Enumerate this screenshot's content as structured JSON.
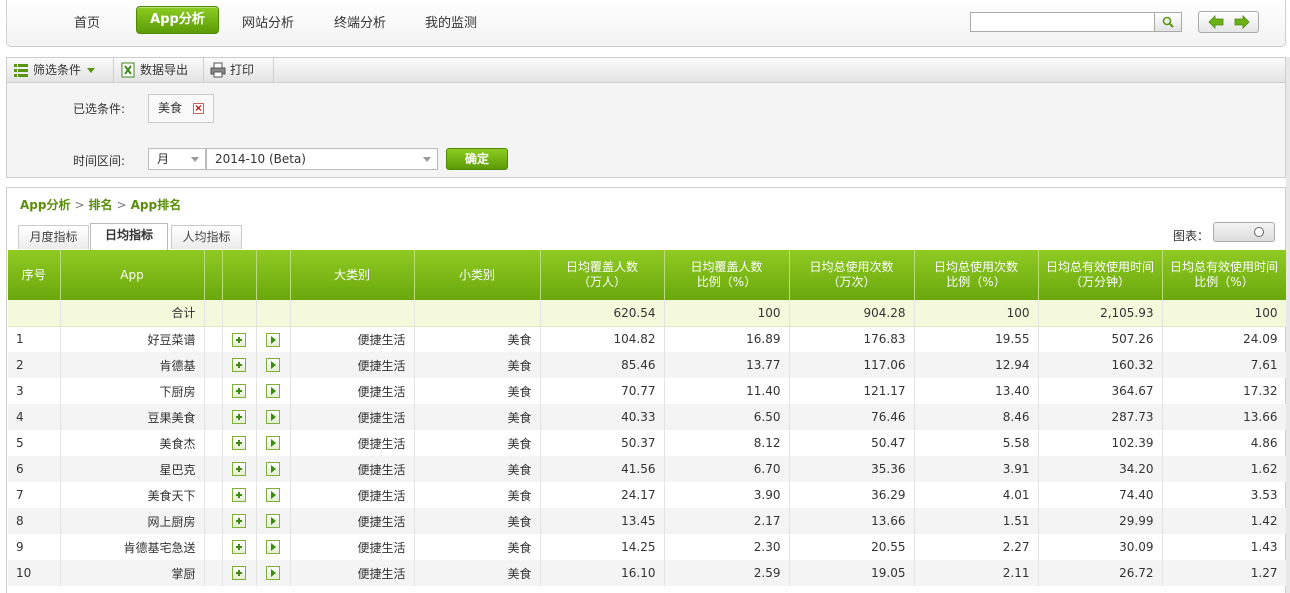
{
  "nav": {
    "items": [
      "首页",
      "App分析",
      "网站分析",
      "终端分析",
      "我的监测"
    ],
    "active": "App分析",
    "search_placeholder": ""
  },
  "toolbar": {
    "filter_label": "筛选条件",
    "export_label": "数据导出",
    "print_label": "打印"
  },
  "filters": {
    "selected_label": "已选条件:",
    "selected_tag": "美食",
    "time_label": "时间区间:",
    "period_value": "月",
    "month_value": "2014-10 (Beta)",
    "confirm_label": "确定"
  },
  "breadcrumb": [
    "App分析",
    "排名",
    "App排名"
  ],
  "tabs": [
    "月度指标",
    "日均指标",
    "人均指标"
  ],
  "active_tab": "日均指标",
  "chart_toggle_label": "图表：",
  "table": {
    "headers": [
      "序号",
      "App",
      "",
      "",
      "大类别",
      "小类别",
      "日均覆盖人数\n（万人）",
      "日均覆盖人数\n比例（%）",
      "日均总使用次数\n（万次）",
      "日均总使用次数\n比例（%）",
      "日均总有效使用时间\n（万分钟）",
      "日均总有效使用时间\n比例（%）"
    ],
    "total": {
      "label": "合计",
      "values": [
        "620.54",
        "100",
        "904.28",
        "100",
        "2,105.93",
        "100"
      ]
    },
    "rows": [
      {
        "rank": "1",
        "app": "好豆菜谱",
        "big": "便捷生活",
        "small": "美食",
        "v": [
          "104.82",
          "16.89",
          "176.83",
          "19.55",
          "507.26",
          "24.09"
        ]
      },
      {
        "rank": "2",
        "app": "肯德基",
        "big": "便捷生活",
        "small": "美食",
        "v": [
          "85.46",
          "13.77",
          "117.06",
          "12.94",
          "160.32",
          "7.61"
        ]
      },
      {
        "rank": "3",
        "app": "下厨房",
        "big": "便捷生活",
        "small": "美食",
        "v": [
          "70.77",
          "11.40",
          "121.17",
          "13.40",
          "364.67",
          "17.32"
        ]
      },
      {
        "rank": "4",
        "app": "豆果美食",
        "big": "便捷生活",
        "small": "美食",
        "v": [
          "40.33",
          "6.50",
          "76.46",
          "8.46",
          "287.73",
          "13.66"
        ]
      },
      {
        "rank": "5",
        "app": "美食杰",
        "big": "便捷生活",
        "small": "美食",
        "v": [
          "50.37",
          "8.12",
          "50.47",
          "5.58",
          "102.39",
          "4.86"
        ]
      },
      {
        "rank": "6",
        "app": "星巴克",
        "big": "便捷生活",
        "small": "美食",
        "v": [
          "41.56",
          "6.70",
          "35.36",
          "3.91",
          "34.20",
          "1.62"
        ]
      },
      {
        "rank": "7",
        "app": "美食天下",
        "big": "便捷生活",
        "small": "美食",
        "v": [
          "24.17",
          "3.90",
          "36.29",
          "4.01",
          "74.40",
          "3.53"
        ]
      },
      {
        "rank": "8",
        "app": "网上厨房",
        "big": "便捷生活",
        "small": "美食",
        "v": [
          "13.45",
          "2.17",
          "13.66",
          "1.51",
          "29.99",
          "1.42"
        ]
      },
      {
        "rank": "9",
        "app": "肯德基宅急送",
        "big": "便捷生活",
        "small": "美食",
        "v": [
          "14.25",
          "2.30",
          "20.55",
          "2.27",
          "30.09",
          "1.43"
        ]
      },
      {
        "rank": "10",
        "app": "掌厨",
        "big": "便捷生活",
        "small": "美食",
        "v": [
          "16.10",
          "2.59",
          "19.05",
          "2.11",
          "26.72",
          "1.27"
        ]
      }
    ]
  }
}
